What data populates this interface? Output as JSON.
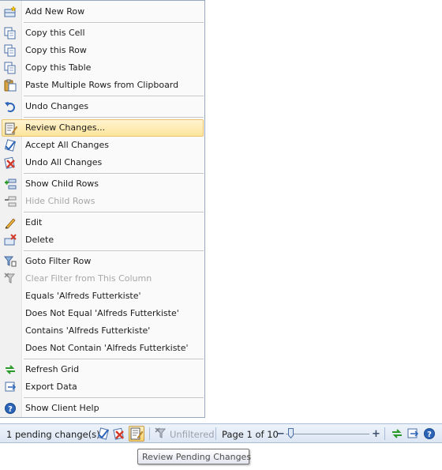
{
  "menu": {
    "items": [
      {
        "label": "Add New Row",
        "icon": "add-row-icon",
        "disabled": false
      },
      {
        "label": "Copy this Cell",
        "icon": "copy-icon",
        "disabled": false
      },
      {
        "label": "Copy this Row",
        "icon": "copy-icon",
        "disabled": false
      },
      {
        "label": "Copy this Table",
        "icon": "copy-icon",
        "disabled": false
      },
      {
        "label": "Paste Multiple Rows from Clipboard",
        "icon": "paste-icon",
        "disabled": false
      },
      {
        "label": "Undo Changes",
        "icon": "undo-icon",
        "disabled": false
      },
      {
        "label": "Review Changes...",
        "icon": "review-icon",
        "disabled": false,
        "highlighted": true
      },
      {
        "label": "Accept All Changes",
        "icon": "accept-icon",
        "disabled": false
      },
      {
        "label": "Undo All Changes",
        "icon": "undo-all-icon",
        "disabled": false
      },
      {
        "label": "Show Child Rows",
        "icon": "show-child-icon",
        "disabled": false
      },
      {
        "label": "Hide Child Rows",
        "icon": "hide-child-icon",
        "disabled": true
      },
      {
        "label": "Edit",
        "icon": "pencil-icon",
        "disabled": false
      },
      {
        "label": "Delete",
        "icon": "delete-icon",
        "disabled": false
      },
      {
        "label": "Goto Filter Row",
        "icon": "filter-icon",
        "disabled": false
      },
      {
        "label": "Clear Filter from This Column",
        "icon": "clear-filter-icon",
        "disabled": true
      },
      {
        "label": "Equals 'Alfreds Futterkiste'",
        "icon": "",
        "disabled": false
      },
      {
        "label": "Does Not Equal 'Alfreds Futterkiste'",
        "icon": "",
        "disabled": false
      },
      {
        "label": "Contains 'Alfreds Futterkiste'",
        "icon": "",
        "disabled": false
      },
      {
        "label": "Does Not Contain 'Alfreds Futterkiste'",
        "icon": "",
        "disabled": false
      },
      {
        "label": "Refresh Grid",
        "icon": "refresh-icon",
        "disabled": false
      },
      {
        "label": "Export Data",
        "icon": "export-icon",
        "disabled": false
      },
      {
        "label": "Show Client Help",
        "icon": "help-icon",
        "disabled": false
      }
    ]
  },
  "statusbar": {
    "pending_text": "1 pending change(s).",
    "filter_label": "Unfiltered",
    "page_text": "Page 1 of 10",
    "zoom_minus": "−",
    "zoom_plus": "+"
  },
  "tooltip": {
    "text": "Review Pending Changes"
  },
  "colors": {
    "highlight": "#fde59c",
    "accent_blue": "#2c64b8"
  }
}
